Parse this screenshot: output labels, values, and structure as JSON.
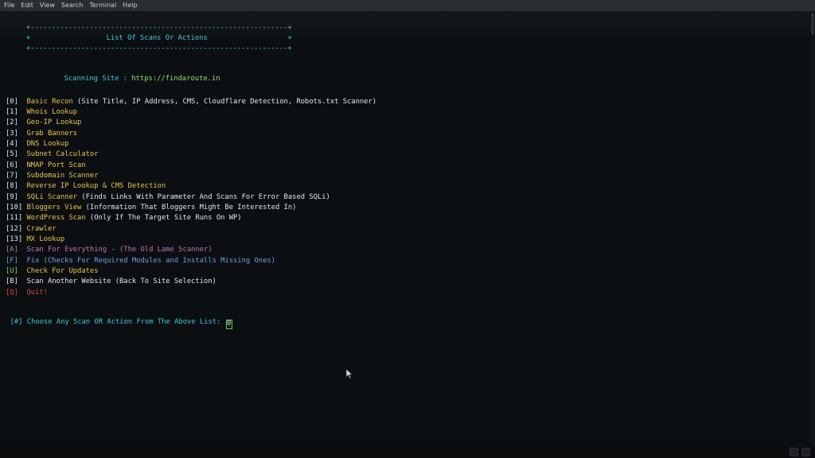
{
  "menubar": {
    "items": [
      "File",
      "Edit",
      "View",
      "Search",
      "Terminal",
      "Help"
    ]
  },
  "terminal": {
    "banner_border_top": "+-------------------------------------------------------------+",
    "banner_title_line": "+                  List Of Scans Or Actions                   +",
    "banner_border_bottom": "+-------------------------------------------------------------+",
    "scanning_label": "Scanning Site : ",
    "scanning_url": "https://findaroute.in",
    "options": [
      {
        "key": "[0]",
        "label": "Basic Recon",
        "desc": " (Site Title, IP Address, CMS, Cloudflare Detection, Robots.txt Scanner)"
      },
      {
        "key": "[1]",
        "label": "Whois Lookup",
        "desc": ""
      },
      {
        "key": "[2]",
        "label": "Geo-IP Lookup",
        "desc": ""
      },
      {
        "key": "[3]",
        "label": "Grab Banners",
        "desc": ""
      },
      {
        "key": "[4]",
        "label": "DNS Lookup",
        "desc": ""
      },
      {
        "key": "[5]",
        "label": "Subnet Calculator",
        "desc": ""
      },
      {
        "key": "[6]",
        "label": "NMAP Port Scan",
        "desc": ""
      },
      {
        "key": "[7]",
        "label": "Subdomain Scanner",
        "desc": ""
      },
      {
        "key": "[8]",
        "label": "Reverse IP Lookup & CMS Detection",
        "desc": ""
      },
      {
        "key": "[9]",
        "label": "SQLi Scanner",
        "desc": " (Finds Links With Parameter And Scans For Error Based SQLi)"
      },
      {
        "key": "[10]",
        "label": "Bloggers View",
        "desc": " (Information That Bloggers Might Be Interested In)"
      },
      {
        "key": "[11]",
        "label": "WordPress Scan",
        "desc": " (Only If The Target Site Runs On WP)"
      },
      {
        "key": "[12]",
        "label": "Crawler",
        "desc": ""
      },
      {
        "key": "[13]",
        "label": "MX Lookup",
        "desc": ""
      }
    ],
    "extra": {
      "a_key": "[A]",
      "a_label": "Scan For Everything - (The Old Lame Scanner)",
      "f_key": "[F]",
      "f_label": "Fix (Checks For Required Modules and Installs Missing Ones)",
      "u_key": "[U]",
      "u_label": "Check For Updates",
      "b_key": "[B]",
      "b_label": "Scan Another Website (Back To Site Selection)",
      "q_key": "[Q]",
      "q_label": "Quit!"
    },
    "prompt": "[#] Choose Any Scan OR Action From The Above List: ",
    "input_value": "0"
  },
  "colors": {
    "background": "#0c0f12",
    "cyan": "#3fc6d8",
    "yellow": "#e8c24a",
    "green": "#7fd35a",
    "purple": "#c473b8",
    "blue": "#6f9fe0",
    "red": "#e14040"
  }
}
